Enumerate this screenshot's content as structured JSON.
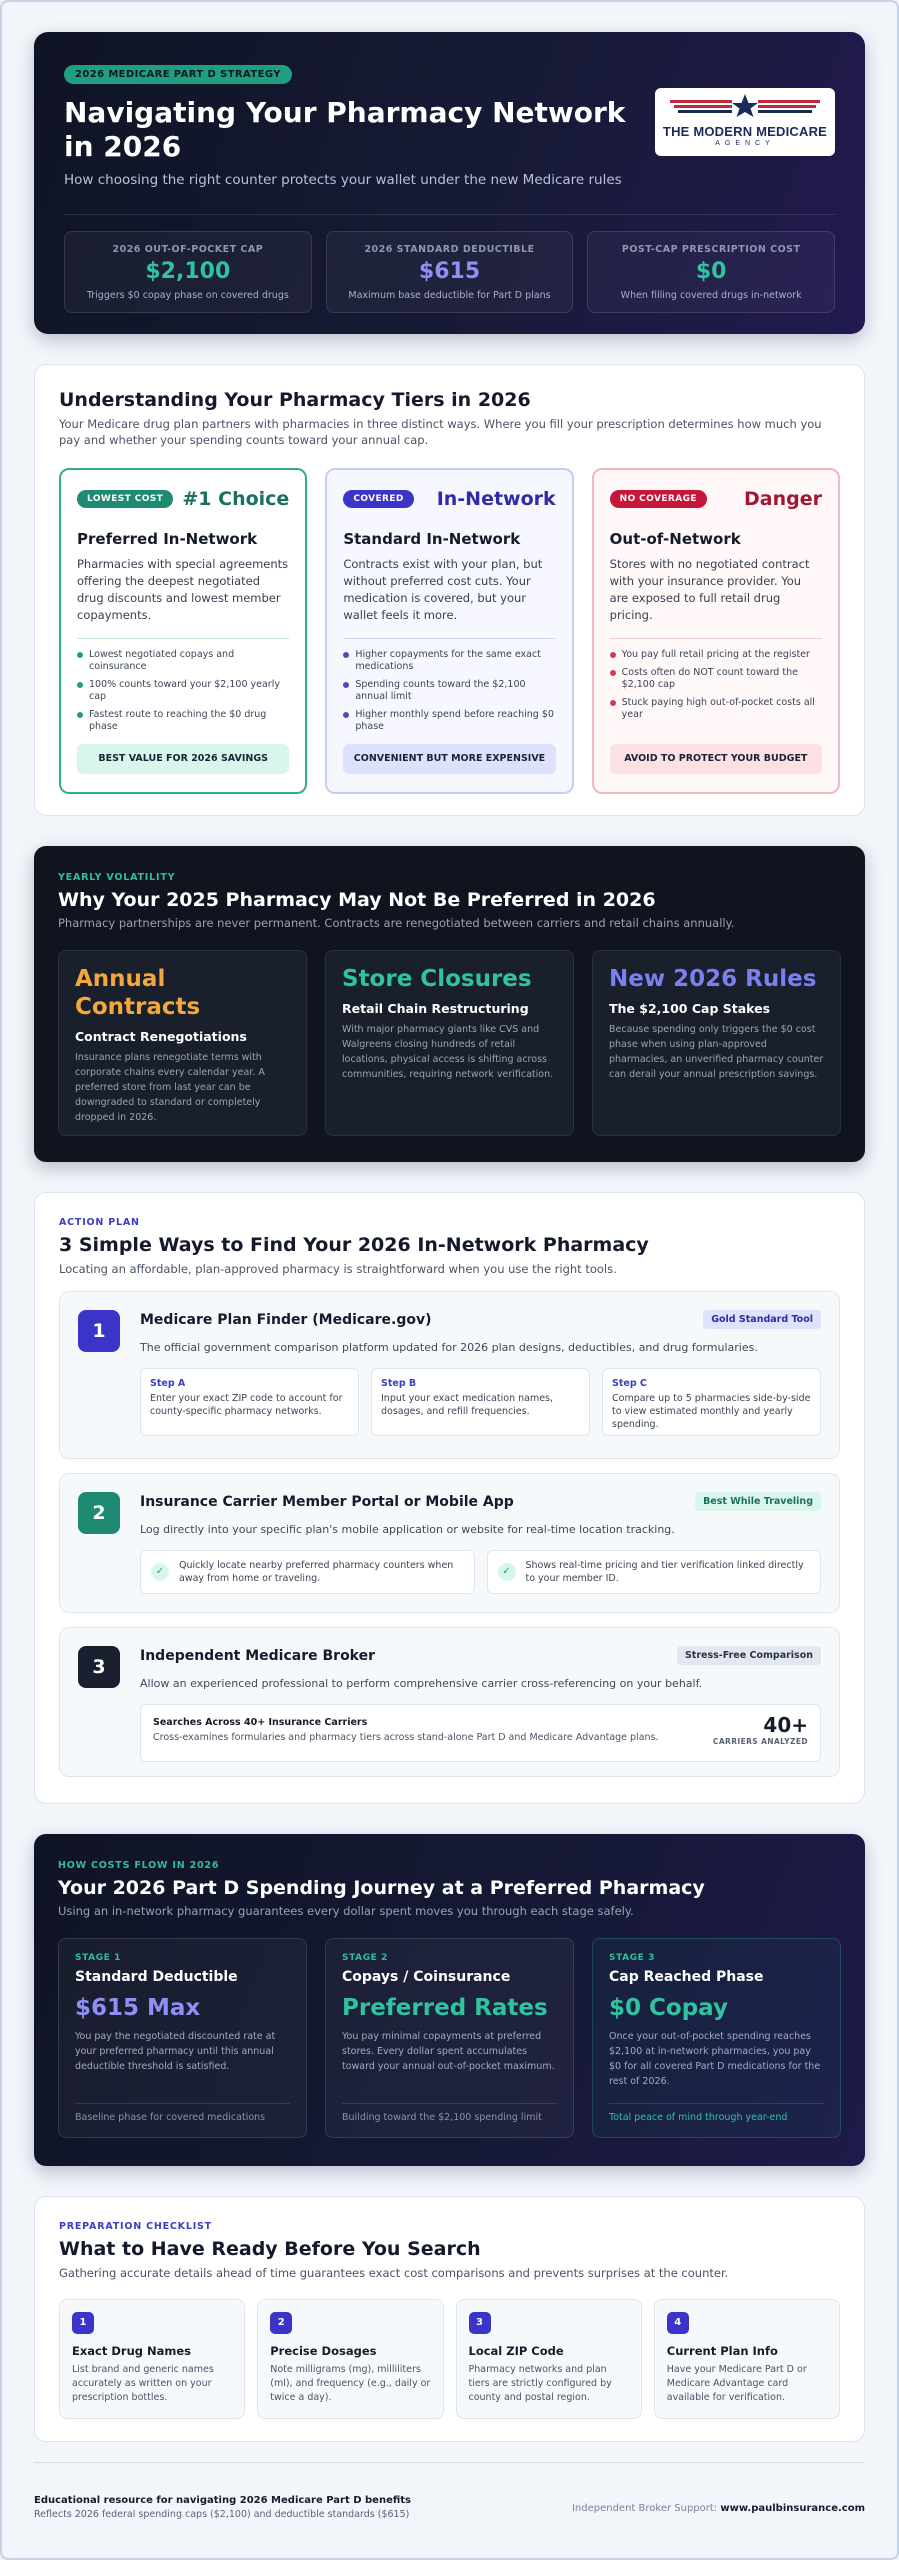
{
  "hero": {
    "badge": "2026 MEDICARE PART D STRATEGY",
    "title": "Navigating Your Pharmacy Network in 2026",
    "subtitle": "How choosing the right counter protects your wallet under the new Medicare rules",
    "logo": {
      "name": "THE MODERN MEDICARE",
      "sub": "AGENCY"
    },
    "stats": [
      {
        "label": "2026 OUT-OF-POCKET CAP",
        "value": "$2,100",
        "desc": "Triggers $0 copay phase on covered drugs",
        "color": "#2fc3a0"
      },
      {
        "label": "2026 STANDARD DEDUCTIBLE",
        "value": "$615",
        "desc": "Maximum base deductible for Part D plans",
        "color": "#8f8ff5"
      },
      {
        "label": "POST-CAP PRESCRIPTION COST",
        "value": "$0",
        "desc": "When filling covered drugs in-network",
        "color": "#2fc3a0"
      }
    ]
  },
  "tiers": {
    "title": "Understanding Your Pharmacy Tiers in 2026",
    "intro": "Your Medicare drug plan partners with pharmacies in three distinct ways. Where you fill your prescription determines how much you pay and whether your spending counts toward your annual cap.",
    "items": [
      {
        "badge": "LOWEST COST",
        "rank": "#1 Choice",
        "title": "Preferred In-Network",
        "body": "Pharmacies with special agreements offering the deepest negotiated drug discounts and lowest member copayments.",
        "bullets": [
          "Lowest negotiated copays and coinsurance",
          "100% counts toward your $2,100 yearly cap",
          "Fastest route to reaching the $0 drug phase"
        ],
        "footer": "BEST VALUE FOR 2026 SAVINGS"
      },
      {
        "badge": "COVERED",
        "rank": "In-Network",
        "title": "Standard In-Network",
        "body": "Contracts exist with your plan, but without preferred cost cuts. Your medication is covered, but your wallet feels it more.",
        "bullets": [
          "Higher copayments for the same exact medications",
          "Spending counts toward the $2,100 annual limit",
          "Higher monthly spend before reaching $0 phase"
        ],
        "footer": "CONVENIENT BUT MORE EXPENSIVE"
      },
      {
        "badge": "NO COVERAGE",
        "rank": "Danger",
        "title": "Out-of-Network",
        "body": "Stores with no negotiated contract with your insurance provider. You are exposed to full retail drug pricing.",
        "bullets": [
          "You pay full retail pricing at the register",
          "Costs often do NOT count toward the $2,100 cap",
          "Stuck paying high out-of-pocket costs all year"
        ],
        "footer": "AVOID TO PROTECT YOUR BUDGET"
      }
    ]
  },
  "volatility": {
    "eyebrow": "YEARLY VOLATILITY",
    "title": "Why Your 2025 Pharmacy May Not Be Preferred in 2026",
    "intro": "Pharmacy partnerships are never permanent. Contracts are renegotiated between carriers and retail chains annually.",
    "items": [
      {
        "big": "Annual Contracts",
        "title": "Contract Renegotiations",
        "body": "Insurance plans renegotiate terms with corporate chains every calendar year. A preferred store from last year can be downgraded to standard or completely dropped in 2026.",
        "color": "#f2a93b"
      },
      {
        "big": "Store Closures",
        "title": "Retail Chain Restructuring",
        "body": "With major pharmacy giants like CVS and Walgreens closing hundreds of retail locations, physical access is shifting across communities, requiring network verification.",
        "color": "#2fc3a0"
      },
      {
        "big": "New 2026 Rules",
        "title": "The $2,100 Cap Stakes",
        "body": "Because spending only triggers the $0 cost phase when using plan-approved pharmacies, an unverified pharmacy counter can derail your annual prescription savings.",
        "color": "#7b7ff2"
      }
    ]
  },
  "action": {
    "eyebrow": "ACTION PLAN",
    "title": "3 Simple Ways to Find Your 2026 In-Network Pharmacy",
    "intro": "Locating an affordable, plan-approved pharmacy is straightforward when you use the right tools.",
    "step1": {
      "num": "1",
      "title": "Medicare Plan Finder (Medicare.gov)",
      "tag": "Gold Standard Tool",
      "desc": "The official government comparison platform updated for 2026 plan designs, deductibles, and drug formularies.",
      "subs": [
        {
          "t": "Step A",
          "d": "Enter your exact ZIP code to account for county-specific pharmacy networks."
        },
        {
          "t": "Step B",
          "d": "Input your exact medication names, dosages, and refill frequencies."
        },
        {
          "t": "Step C",
          "d": "Compare up to 5 pharmacies side-by-side to view estimated monthly and yearly spending."
        }
      ]
    },
    "step2": {
      "num": "2",
      "title": "Insurance Carrier Member Portal or Mobile App",
      "tag": "Best While Traveling",
      "desc": "Log directly into your specific plan's mobile application or website for real-time location tracking.",
      "checks": [
        "Quickly locate nearby preferred pharmacy counters when away from home or traveling.",
        "Shows real-time pricing and tier verification linked directly to your member ID."
      ]
    },
    "step3": {
      "num": "3",
      "title": "Independent Medicare Broker",
      "tag": "Stress-Free Comparison",
      "desc": "Allow an experienced professional to perform comprehensive carrier cross-referencing on your behalf.",
      "box_title": "Searches Across 40+ Insurance Carriers",
      "box_desc": "Cross-examines formularies and pharmacy tiers across stand-alone Part D and Medicare Advantage plans.",
      "count": "40+",
      "count_label": "CARRIERS ANALYZED"
    }
  },
  "journey": {
    "eyebrow": "HOW COSTS FLOW IN 2026",
    "title": "Your 2026 Part D Spending Journey at a Preferred Pharmacy",
    "intro": "Using an in-network pharmacy guarantees every dollar spent moves you through each stage safely.",
    "stages": [
      {
        "label": "STAGE 1",
        "title": "Standard Deductible",
        "big": "$615 Max",
        "body": "You pay the negotiated discounted rate at your preferred pharmacy until this annual deductible threshold is satisfied.",
        "footer": "Baseline phase for covered medications",
        "color": "#8f8ff5",
        "footer_color": "#8a92a8"
      },
      {
        "label": "STAGE 2",
        "title": "Copays / Coinsurance",
        "big": "Preferred Rates",
        "body": "You pay minimal copayments at preferred stores. Every dollar spent accumulates toward your annual out-of-pocket maximum.",
        "footer": "Building toward the $2,100 spending limit",
        "color": "#2fc3a0",
        "footer_color": "#8a92a8"
      },
      {
        "label": "STAGE 3",
        "title": "Cap Reached Phase",
        "big": "$0 Copay",
        "body": "Once your out-of-pocket spending reaches $2,100 at in-network pharmacies, you pay $0 for all covered Part D medications for the rest of 2026.",
        "footer": "Total peace of mind through year-end",
        "color": "#2fc3a0",
        "footer_color": "#2fc3a0"
      }
    ]
  },
  "checklist": {
    "eyebrow": "PREPARATION CHECKLIST",
    "title": "What to Have Ready Before You Search",
    "intro": "Gathering accurate details ahead of time guarantees exact cost comparisons and prevents surprises at the counter.",
    "items": [
      {
        "num": "1",
        "title": "Exact Drug Names",
        "body": "List brand and generic names accurately as written on your prescription bottles."
      },
      {
        "num": "2",
        "title": "Precise Dosages",
        "body": "Note milligrams (mg), milliliters (ml), and frequency (e.g., daily or twice a day)."
      },
      {
        "num": "3",
        "title": "Local ZIP Code",
        "body": "Pharmacy networks and plan tiers are strictly configured by county and postal region."
      },
      {
        "num": "4",
        "title": "Current Plan Info",
        "body": "Have your Medicare Part D or Medicare Advantage card available for verification."
      }
    ]
  },
  "footer": {
    "line1": "Educational resource for navigating 2026 Medicare Part D benefits",
    "line2": "Reflects 2026 federal spending caps ($2,100) and deductible standards ($615)",
    "support_label": "Independent Broker Support:",
    "support_site": "www.paulbinsurance.com"
  }
}
